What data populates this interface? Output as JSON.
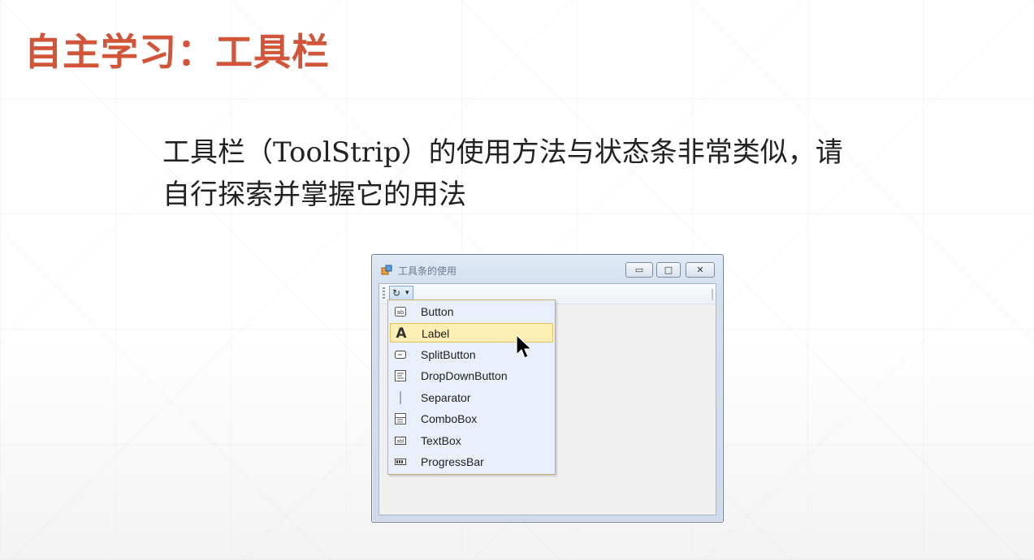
{
  "slide": {
    "title": "自主学习：工具栏",
    "body_line1": "工具栏（ToolStrip）的使用方法与状态条非常类似，请",
    "body_line2": "自行探索并掌握它的用法"
  },
  "window": {
    "title": "工具条的使用",
    "controls": {
      "minimize": "▭",
      "maximize": "□",
      "close": "✕"
    },
    "toolstrip_button_glyph": "↻",
    "toolstrip_dropdown_glyph": "▾"
  },
  "menu": {
    "items": [
      {
        "label": "Button",
        "icon": "button-icon",
        "glyph": "ab"
      },
      {
        "label": "Label",
        "icon": "label-icon",
        "glyph": "A"
      },
      {
        "label": "SplitButton",
        "icon": "split-button-icon",
        "glyph": "▭"
      },
      {
        "label": "DropDownButton",
        "icon": "dropdown-button-icon",
        "glyph": "☰"
      },
      {
        "label": "Separator",
        "icon": "separator-icon",
        "glyph": "|"
      },
      {
        "label": "ComboBox",
        "icon": "combobox-icon",
        "glyph": "▤"
      },
      {
        "label": "TextBox",
        "icon": "textbox-icon",
        "glyph": "abl"
      },
      {
        "label": "ProgressBar",
        "icon": "progressbar-icon",
        "glyph": "▬"
      }
    ],
    "highlighted_index": 1
  },
  "colors": {
    "title": "#d2553a",
    "menu_bg": "#eaf0fb",
    "highlight": "#fdeeb3"
  }
}
